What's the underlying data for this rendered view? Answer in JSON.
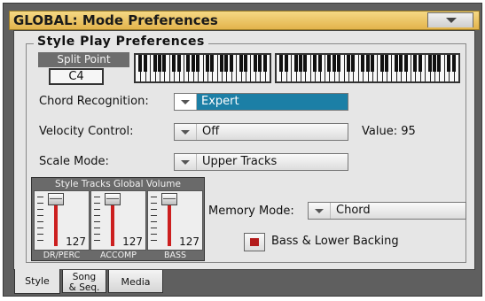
{
  "window": {
    "title": "GLOBAL: Mode Preferences"
  },
  "group": {
    "title": "Style Play Preferences"
  },
  "split_point": {
    "label": "Split Point",
    "value": "C4"
  },
  "chord_recognition": {
    "label": "Chord Recognition:",
    "value": "Expert"
  },
  "velocity_control": {
    "label": "Velocity Control:",
    "value": "Off",
    "readout": "Value: 95"
  },
  "scale_mode": {
    "label": "Scale Mode:",
    "value": "Upper Tracks"
  },
  "mixer": {
    "title": "Style Tracks Global Volume",
    "channels": [
      {
        "name": "DR/PERC",
        "volume": "127"
      },
      {
        "name": "ACCOMP",
        "volume": "127"
      },
      {
        "name": "BASS",
        "volume": "127"
      }
    ]
  },
  "memory_mode": {
    "label": "Memory Mode:",
    "value": "Chord"
  },
  "bass_lower_backing": {
    "label": "Bass & Lower Backing",
    "checked": true
  },
  "tabs": [
    {
      "label": "Style",
      "active": true
    },
    {
      "label": "Song",
      "label2": "& Seq.",
      "active": false
    },
    {
      "label": "Media",
      "active": false
    }
  ],
  "colors": {
    "title_bar": "#e9c05c",
    "selection": "#1c7fa6",
    "checkbox_mark": "#b31b1b",
    "fader_track": "#cc1f1f"
  }
}
